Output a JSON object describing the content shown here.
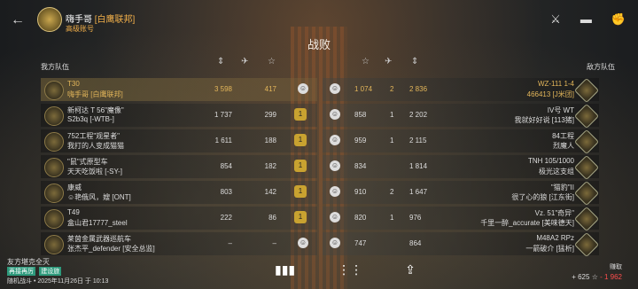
{
  "header": {
    "player_name": "嗨手哥",
    "player_clan": "[白鹰联邦]",
    "account_type": "高级账号",
    "result": "战败"
  },
  "icons": {
    "back": "←",
    "swords": "⚔",
    "tank": "▬",
    "fist": "✊",
    "bars": "▮▮▮",
    "dots": "⋮⋮",
    "share": "⇪"
  },
  "teams": {
    "left": "我方队伍",
    "right": "敌方队伍"
  },
  "rows": [
    {
      "l_tank": "T30",
      "l_player": "嗨手哥 [白鹰联邦]",
      "l_dmg": "3 598",
      "l_xp": "417",
      "l_medal": "",
      "r_medal": "",
      "r_dmg": "1 074",
      "r_kills": "2",
      "r_xp": "2 836",
      "r_tank": "WZ-111 1-4",
      "r_player": "466413 [J米团]"
    },
    {
      "l_tank": "新柯达 T 56\"魔像\"",
      "l_player": "S2b3q [-WTB-]",
      "l_dmg": "1 737",
      "l_xp": "299",
      "l_medal": "1",
      "r_medal": "",
      "r_dmg": "858",
      "r_kills": "1",
      "r_xp": "2 202",
      "r_tank": "IV号 WT",
      "r_player": "我就好好说 [113猪]"
    },
    {
      "l_tank": "752工程\"观星者\"",
      "l_player": "我打的人变成猫猫",
      "l_dmg": "1 611",
      "l_xp": "188",
      "l_medal": "1",
      "r_medal": "",
      "r_dmg": "959",
      "r_kills": "1",
      "r_xp": "2 115",
      "r_tank": "84工程",
      "r_player": "烈魔人"
    },
    {
      "l_tank": "\"鼠\"式原型车",
      "l_player": "天天吃饭啦 [-SY-]",
      "l_dmg": "854",
      "l_xp": "182",
      "l_medal": "1",
      "r_medal": "",
      "r_dmg": "834",
      "r_kills": "",
      "r_xp": "1 814",
      "r_tank": "TNH 105/1000",
      "r_player": "极光这支组"
    },
    {
      "l_tank": "康威",
      "l_player": "☺艳俄风，嫂 [ONT]",
      "l_dmg": "803",
      "l_xp": "142",
      "l_medal": "1",
      "r_medal": "",
      "r_dmg": "910",
      "r_kills": "2",
      "r_xp": "1 647",
      "r_tank": "\"猫豹\"II",
      "r_player": "很了心的狼 [江东街]"
    },
    {
      "l_tank": "T49",
      "l_player": "盒山君17777_steel",
      "l_dmg": "222",
      "l_xp": "86",
      "l_medal": "1",
      "r_medal": "",
      "r_dmg": "820",
      "r_kills": "1",
      "r_xp": "976",
      "r_tank": "Vz. 51\"奇异\"",
      "r_player": "千里一醉_accurate [美味德天]"
    },
    {
      "l_tank": "莱茵金属武器巡航车",
      "l_player": "张杰平_defender [安全总监]",
      "l_dmg": "–",
      "l_xp": "–",
      "l_medal": "",
      "r_medal": "",
      "r_dmg": "747",
      "r_kills": "",
      "r_xp": "864",
      "r_tank": "M48A2 RPz",
      "r_player": "一箭破介 [猛析]"
    }
  ],
  "footer": {
    "line1": "友方堪克全灭",
    "tag1": "再接再厉",
    "tag2": "建设旅",
    "line3": "随机战斗 • 2025年11月26日 于 10:13",
    "earn_label": "赚取",
    "earn_xp": "+ 625",
    "earn_credits": "- 1 962"
  }
}
